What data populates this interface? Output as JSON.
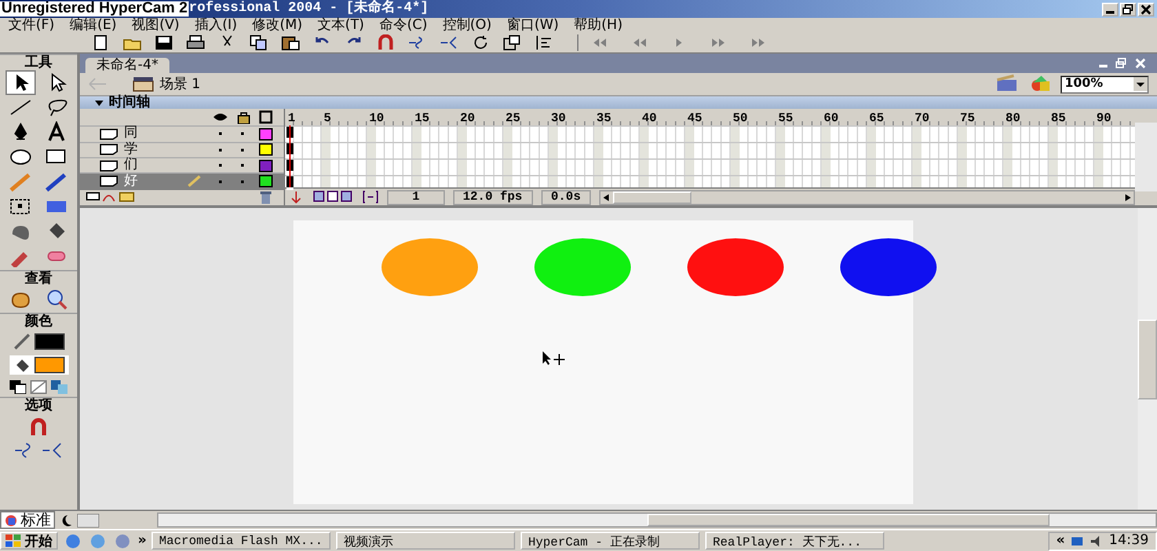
{
  "recorder_overlay": "Unregistered HyperCam 2",
  "window": {
    "title": "rofessional 2004 - [未命名-4*]"
  },
  "menu": [
    "文件(F)",
    "编辑(E)",
    "视图(V)",
    "插入(I)",
    "修改(M)",
    "文本(T)",
    "命令(C)",
    "控制(O)",
    "窗口(W)",
    "帮助(H)"
  ],
  "tools_panel": {
    "title": "工具",
    "view_title": "查看",
    "colors_title": "颜色",
    "options_title": "选项"
  },
  "document": {
    "tab": "未命名-4*",
    "scene": "场景 1",
    "zoom": "100%"
  },
  "timeline": {
    "title": "时间轴",
    "ruler": [
      "1",
      "5",
      "10",
      "15",
      "20",
      "25",
      "30",
      "35",
      "40",
      "45",
      "50",
      "55",
      "60",
      "65",
      "70",
      "75",
      "80",
      "85",
      "90"
    ],
    "layers": [
      {
        "name": "同",
        "color": "#ff40ff",
        "selected": false
      },
      {
        "name": "学",
        "color": "#ffff00",
        "selected": false
      },
      {
        "name": "们",
        "color": "#8020c0",
        "selected": false
      },
      {
        "name": "好",
        "color": "#20e020",
        "selected": true
      }
    ],
    "current_frame": "1",
    "frame_rate": "12.0 fps",
    "elapsed": "0.0s"
  },
  "stage": {
    "shapes": [
      {
        "color": "#ffa010"
      },
      {
        "color": "#10f010"
      },
      {
        "color": "#ff1010"
      },
      {
        "color": "#1010f0"
      }
    ]
  },
  "panel_tab": "标准",
  "taskbar": {
    "start": "开始",
    "more": "»",
    "tasks": [
      {
        "label": "Macromedia Flash MX..."
      },
      {
        "label": "视频演示"
      },
      {
        "label": "HyperCam - 正在录制"
      },
      {
        "label": "RealPlayer: 天下无..."
      }
    ],
    "tray_more": "«",
    "time": "14:39"
  }
}
